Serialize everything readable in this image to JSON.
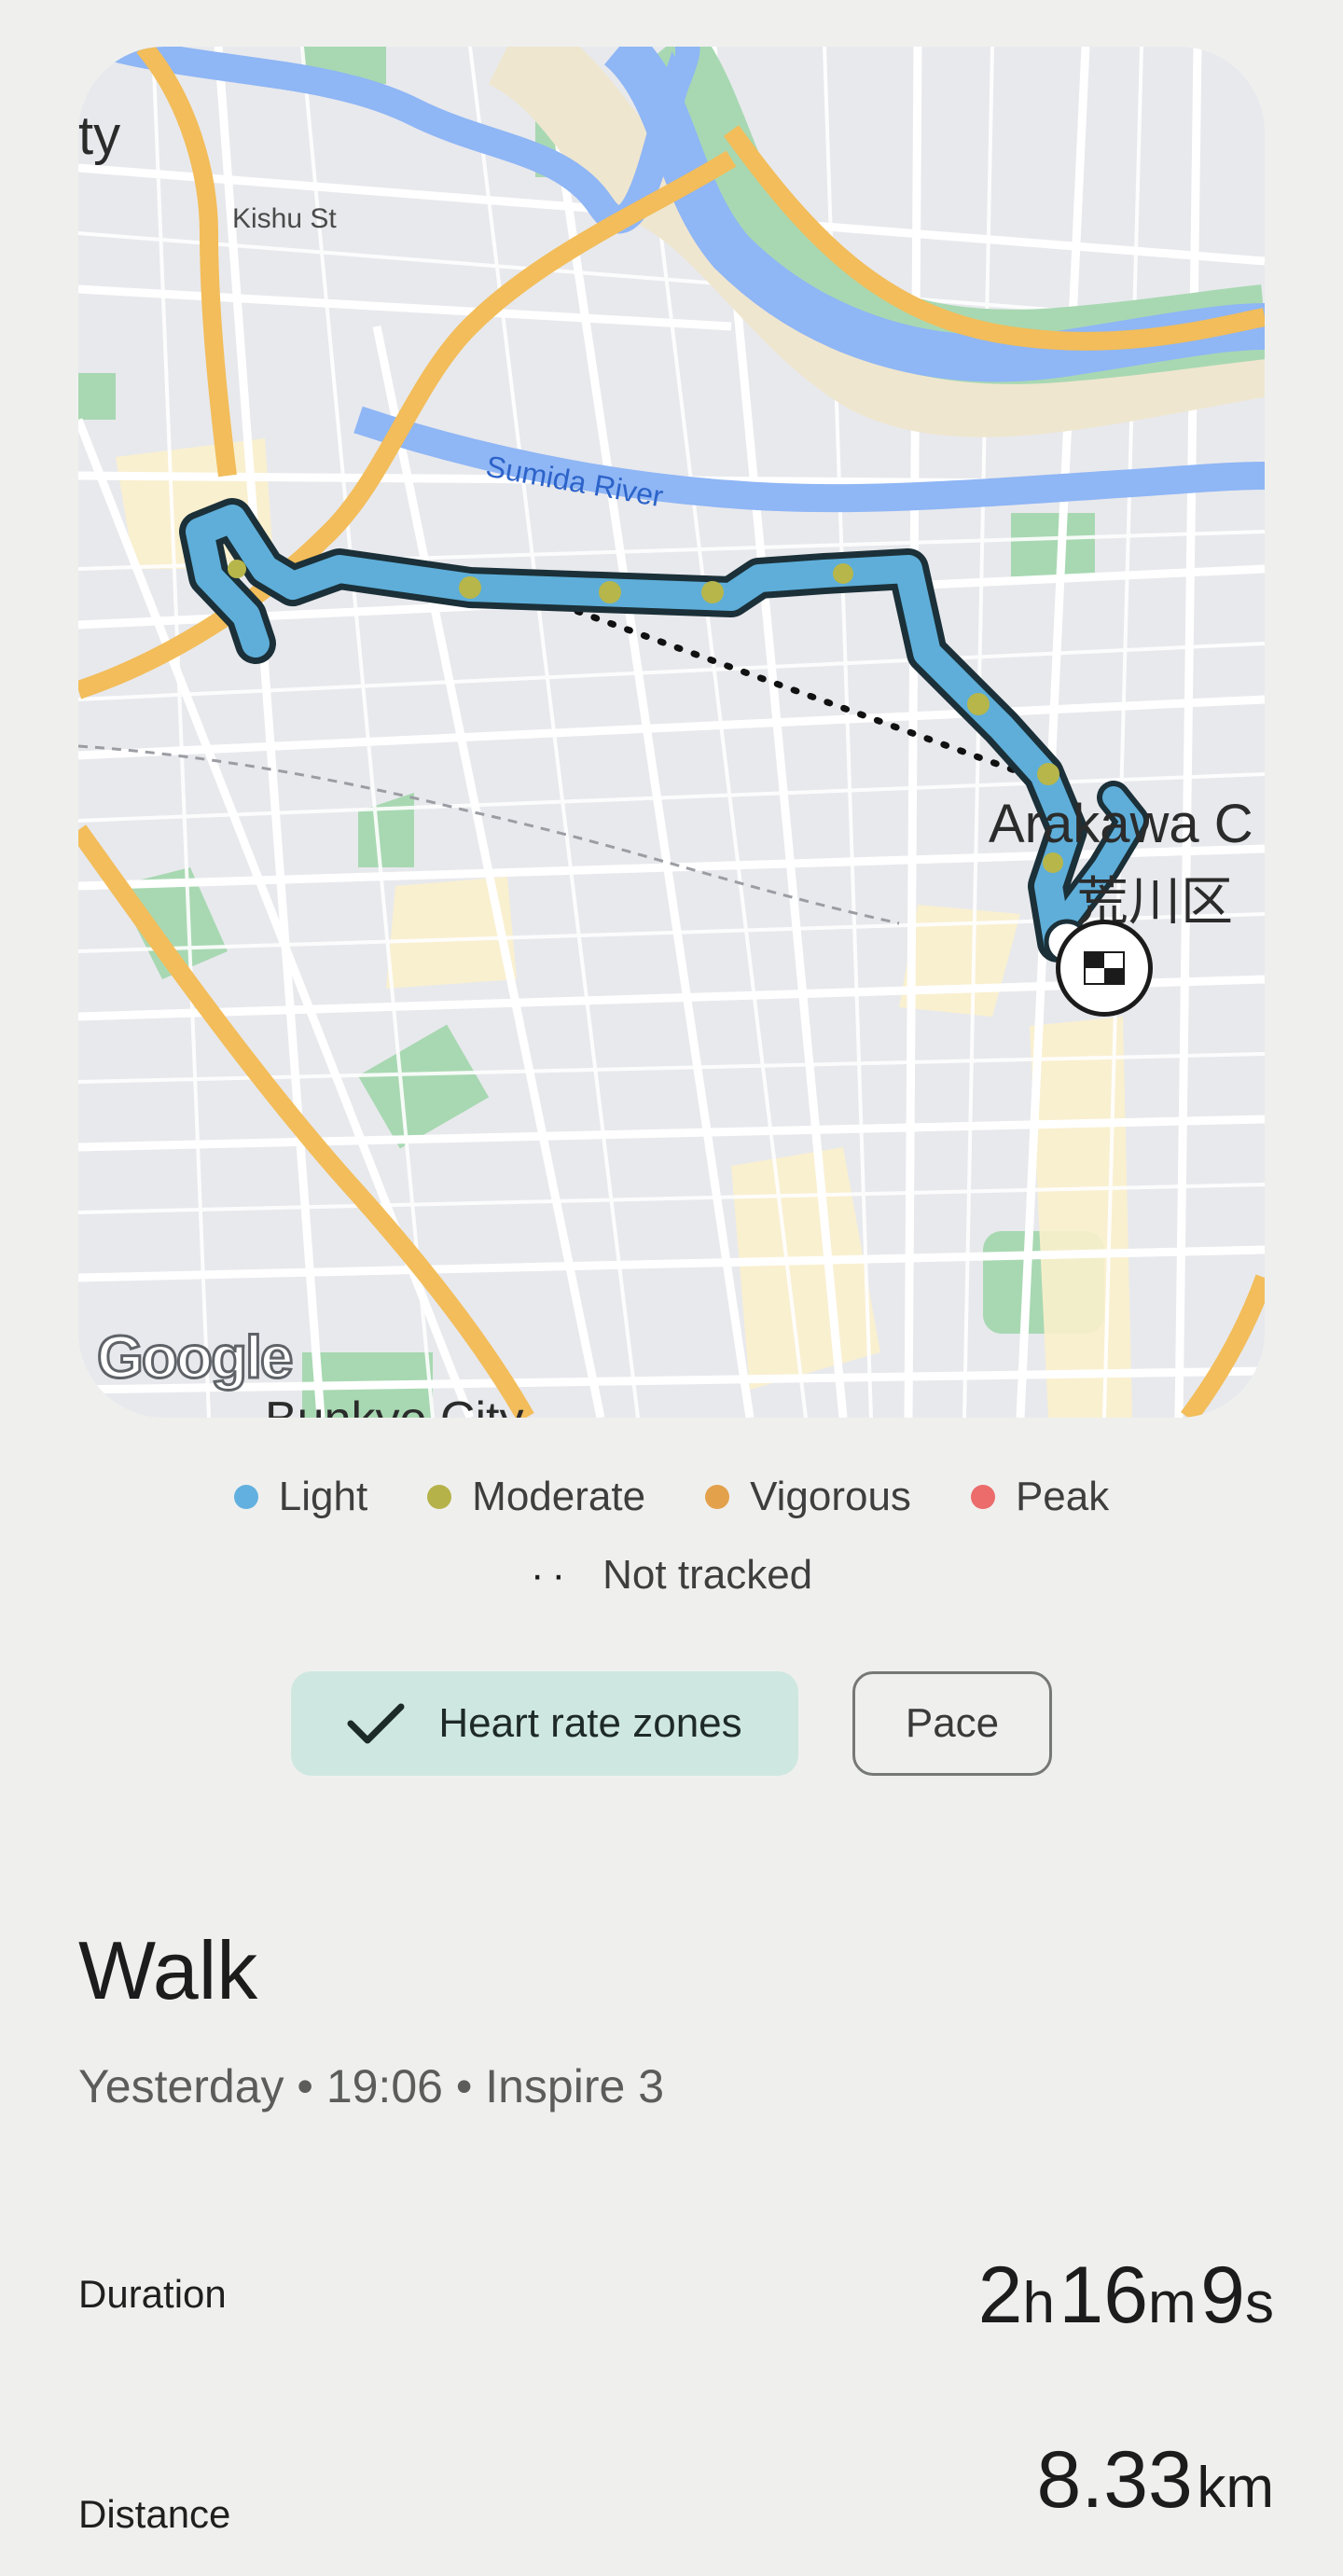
{
  "map": {
    "labels": {
      "city_fragment": "ty",
      "kishu_st": "Kishu St",
      "sumida_river": "Sumida River",
      "arakawa": "Arakawa C",
      "arakawa_kanji": "荒川区",
      "bunkyo": "Bunkyo City",
      "google": "Google"
    },
    "icons": {
      "finish": "checkered-flag-icon"
    },
    "colors": {
      "route": "#5eaed9",
      "route_outline": "#1b3a45",
      "moderate": "#b7b64a"
    }
  },
  "legend": {
    "items": [
      {
        "label": "Light",
        "color": "#62b0df"
      },
      {
        "label": "Moderate",
        "color": "#b6b24a"
      },
      {
        "label": "Vigorous",
        "color": "#e3a14c"
      },
      {
        "label": "Peak",
        "color": "#ec6b6b"
      }
    ],
    "not_tracked": {
      "symbol": "··",
      "label": "Not tracked"
    }
  },
  "toggles": {
    "heart_rate": {
      "label": "Heart rate zones",
      "icon": "check-icon",
      "selected": true
    },
    "pace": {
      "label": "Pace",
      "selected": false
    }
  },
  "activity": {
    "title": "Walk",
    "subtitle": "Yesterday • 19:06 • Inspire 3"
  },
  "stats": {
    "duration": {
      "label": "Duration",
      "h": "2",
      "h_unit": "h",
      "m": "16",
      "m_unit": "m",
      "s": "9",
      "s_unit": "s"
    },
    "distance": {
      "label": "Distance",
      "value": "8.33",
      "unit": "km"
    }
  }
}
